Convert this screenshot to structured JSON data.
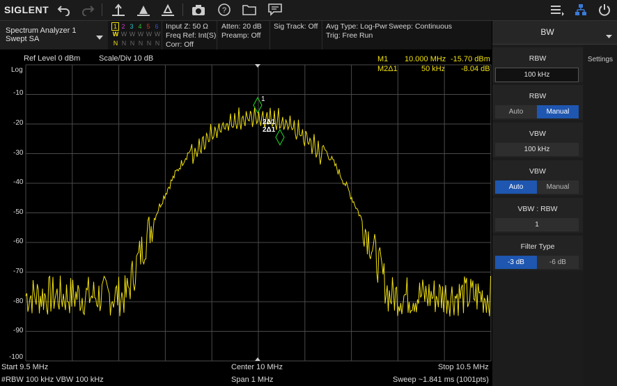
{
  "toolbar": {
    "logo": "SIGLENT",
    "icons": [
      "undo-icon",
      "redo-icon",
      "peak-search-icon",
      "marker-icon",
      "marker-delta-icon",
      "camera-icon",
      "help-icon",
      "folder-icon",
      "message-icon",
      "menu-list-icon",
      "network-icon",
      "power-icon"
    ]
  },
  "status": {
    "mode_title": "Spectrum Analyzer 1",
    "mode_sub": "Swept SA",
    "trace_numbers": [
      "1",
      "2",
      "3",
      "4",
      "5",
      "6"
    ],
    "trace_types": [
      "W",
      "W",
      "W",
      "W",
      "W",
      "W"
    ],
    "trace_detectors": [
      "N",
      "N",
      "N",
      "N",
      "N",
      "N"
    ],
    "input_z": "Input Z: 50 Ω",
    "freq_ref": "Freq Ref: Int(S)",
    "corr": "Corr: Off",
    "atten": "Atten: 20 dB",
    "preamp": "Preamp: Off",
    "sig_track": "Sig Track: Off",
    "avg_type": "Avg Type: Log-Pwr",
    "trig": "Trig: Free Run",
    "sweep": "Sweep: Continuous"
  },
  "graph": {
    "ref_level": "Ref Level  0 dBm",
    "scale_div": "Scale/Div  10 dB",
    "log_label": "Log",
    "y_ticks": [
      "-10",
      "-20",
      "-30",
      "-40",
      "-50",
      "-60",
      "-70",
      "-80",
      "-90",
      "-100"
    ],
    "marker1_label": "M1",
    "marker1_freq": "10.000 MHz",
    "marker1_amp": "-15.70 dBm",
    "marker2_label": "M2Δ1",
    "marker2_freq": "50 kHz",
    "marker2_amp": "-8.04 dB",
    "marker1_tag": "1",
    "marker2_tag_a": "2Δ1",
    "marker2_tag_b": "2Δ1",
    "start": "Start  9.5 MHz",
    "center": "Center  10 MHz",
    "stop": "Stop  10.5 MHz",
    "rbw_vbw": "#RBW  100 kHz   VBW  100 kHz",
    "span": "Span  1 MHz",
    "sweep_time": "Sweep  ~1.841 ms (1001pts)",
    "trace_color": "#f0e010"
  },
  "panel": {
    "title": "BW",
    "side_tab": "Settings",
    "rbw_label": "RBW",
    "rbw_value": "100 kHz",
    "rbw_mode_label": "RBW",
    "rbw_auto": "Auto",
    "rbw_manual": "Manual",
    "vbw_label": "VBW",
    "vbw_value": "100 kHz",
    "vbw_mode_label": "VBW",
    "vbw_auto": "Auto",
    "vbw_manual": "Manual",
    "ratio_label": "VBW : RBW",
    "ratio_value": "1",
    "filter_label": "Filter Type",
    "filter_3db": "-3 dB",
    "filter_6db": "-6 dB",
    "accent": "#1e56b0"
  }
}
